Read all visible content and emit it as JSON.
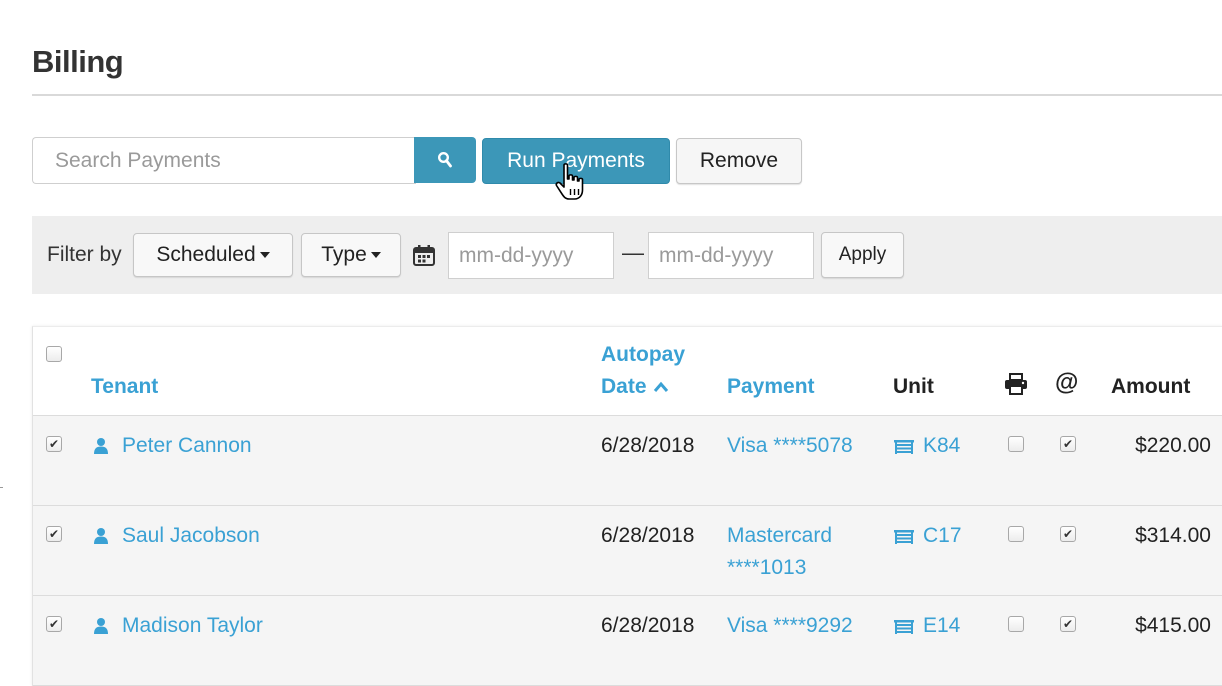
{
  "page": {
    "title": "Billing"
  },
  "toolbar": {
    "search_placeholder": "Search Payments",
    "search_icon": "search-icon",
    "run_label": "Run Payments",
    "remove_label": "Remove"
  },
  "filter": {
    "label": "Filter by",
    "scheduled_label": "Scheduled",
    "type_label": "Type",
    "calendar_icon": "calendar-icon",
    "date_from_placeholder": "mm-dd-yyyy",
    "date_separator": "—",
    "date_to_placeholder": "mm-dd-yyyy",
    "apply_label": "Apply"
  },
  "table": {
    "headers": {
      "tenant": "Tenant",
      "autopay_line1": "Autopay",
      "autopay_line2": "Date",
      "payment": "Payment",
      "unit": "Unit",
      "print_icon": "printer-icon",
      "email_icon": "@",
      "amount": "Amount"
    },
    "sort": {
      "column": "Autopay Date",
      "direction": "ascending"
    },
    "select_all_checked": false,
    "rows": [
      {
        "selected": true,
        "tenant": "Peter Cannon",
        "date": "6/28/2018",
        "payment_line1": "Visa ****5078",
        "payment_line2": "",
        "unit": "K84",
        "print": false,
        "email": true,
        "amount": "$220.00"
      },
      {
        "selected": true,
        "tenant": "Saul Jacobson",
        "date": "6/28/2018",
        "payment_line1": "Mastercard",
        "payment_line2": "****1013",
        "unit": "C17",
        "print": false,
        "email": true,
        "amount": "$314.00"
      },
      {
        "selected": true,
        "tenant": "Madison Taylor",
        "date": "6/28/2018",
        "payment_line1": "Visa ****9292",
        "payment_line2": "",
        "unit": "E14",
        "print": false,
        "email": true,
        "amount": "$415.00"
      }
    ]
  },
  "colors": {
    "accent": "#3c97b8",
    "link": "#3aa1d4",
    "filter_bg": "#eeeeee",
    "row_bg": "#f5f5f5"
  }
}
